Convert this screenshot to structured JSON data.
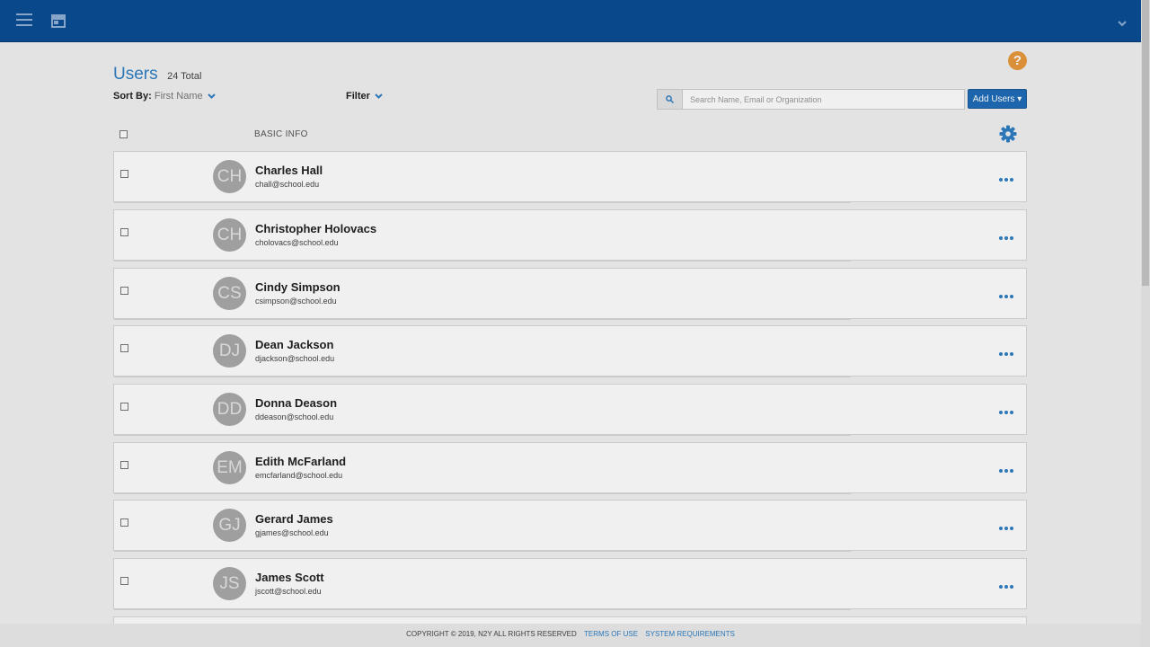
{
  "header": {
    "menu_icon": "hamburger-icon",
    "store_icon": "storefront-icon",
    "account_icon": "chevron-down-icon"
  },
  "page": {
    "title": "Users",
    "total": "24 Total",
    "sort_label": "Sort By:",
    "sort_value": "First Name",
    "filter_label": "Filter",
    "search_placeholder": "Search Name, Email or Organization",
    "add_users_label": "Add Users ▾",
    "help_label": "?",
    "column_header": "BASIC INFO"
  },
  "users": [
    {
      "initials": "CH",
      "name": "Charles Hall",
      "email": "chall@school.edu"
    },
    {
      "initials": "CH",
      "name": "Christopher Holovacs",
      "email": "cholovacs@school.edu"
    },
    {
      "initials": "CS",
      "name": "Cindy Simpson",
      "email": "csimpson@school.edu"
    },
    {
      "initials": "DJ",
      "name": "Dean Jackson",
      "email": "djackson@school.edu"
    },
    {
      "initials": "DD",
      "name": "Donna Deason",
      "email": "ddeason@school.edu"
    },
    {
      "initials": "EM",
      "name": "Edith McFarland",
      "email": "emcfarland@school.edu"
    },
    {
      "initials": "GJ",
      "name": "Gerard James",
      "email": "gjames@school.edu"
    },
    {
      "initials": "JS",
      "name": "James Scott",
      "email": "jscott@school.edu"
    }
  ],
  "footer": {
    "copyright": "COPYRIGHT © 2019, N2Y ALL RIGHTS RESERVED",
    "terms": "TERMS OF USE",
    "requirements": "SYSTEM REQUIREMENTS"
  },
  "colors": {
    "header_bg": "#0a4d94",
    "accent": "#2e7fc4",
    "button": "#1f6db8",
    "help": "#e89a3c",
    "avatar": "#a9a9a9"
  }
}
